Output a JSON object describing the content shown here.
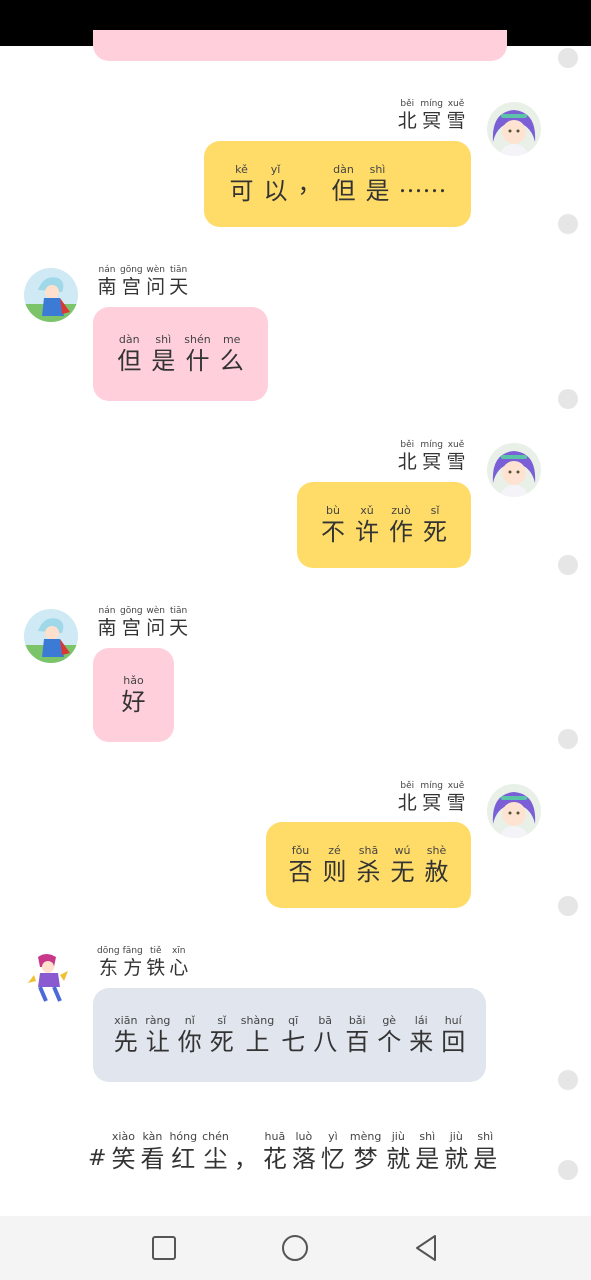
{
  "messages": [
    {
      "side": "right",
      "sender": "beiming",
      "name": [
        [
          "běi",
          "北"
        ],
        [
          "míng",
          "冥"
        ],
        [
          "xuě",
          "雪"
        ]
      ],
      "text": [
        [
          "kě",
          "可"
        ],
        [
          "yǐ",
          "以"
        ],
        [
          "",
          "，"
        ],
        [
          "dàn",
          "但"
        ],
        [
          "shì",
          "是"
        ],
        [
          "",
          "……"
        ]
      ]
    },
    {
      "side": "left",
      "sender": "nangong",
      "name": [
        [
          "nán",
          "南"
        ],
        [
          "gōng",
          "宫"
        ],
        [
          "wèn",
          "问"
        ],
        [
          "tiān",
          "天"
        ]
      ],
      "text": [
        [
          "dàn",
          "但"
        ],
        [
          "shì",
          "是"
        ],
        [
          "shén",
          "什"
        ],
        [
          "me",
          "么"
        ]
      ]
    },
    {
      "side": "right",
      "sender": "beiming",
      "name": [
        [
          "běi",
          "北"
        ],
        [
          "míng",
          "冥"
        ],
        [
          "xuě",
          "雪"
        ]
      ],
      "text": [
        [
          "bù",
          "不"
        ],
        [
          "xǔ",
          "许"
        ],
        [
          "zuò",
          "作"
        ],
        [
          "sǐ",
          "死"
        ]
      ]
    },
    {
      "side": "left",
      "sender": "nangong",
      "name": [
        [
          "nán",
          "南"
        ],
        [
          "gōng",
          "宫"
        ],
        [
          "wèn",
          "问"
        ],
        [
          "tiān",
          "天"
        ]
      ],
      "text": [
        [
          "hǎo",
          "好"
        ]
      ]
    },
    {
      "side": "right",
      "sender": "beiming",
      "name": [
        [
          "běi",
          "北"
        ],
        [
          "míng",
          "冥"
        ],
        [
          "xuě",
          "雪"
        ]
      ],
      "text": [
        [
          "fǒu",
          "否"
        ],
        [
          "zé",
          "则"
        ],
        [
          "shā",
          "杀"
        ],
        [
          "wú",
          "无"
        ],
        [
          "shè",
          "赦"
        ]
      ]
    },
    {
      "side": "left",
      "sender": "dongfang",
      "name": [
        [
          "dōng",
          "东"
        ],
        [
          "fāng",
          "方"
        ],
        [
          "tiě",
          "铁"
        ],
        [
          "xīn",
          "心"
        ]
      ],
      "text": [
        [
          "xiān",
          "先"
        ],
        [
          "ràng",
          "让"
        ],
        [
          "nǐ",
          "你"
        ],
        [
          "sǐ",
          "死"
        ],
        [
          "shàng",
          "上"
        ],
        [
          "qī",
          "七"
        ],
        [
          "bā",
          "八"
        ],
        [
          "bǎi",
          "百"
        ],
        [
          "gè",
          "个"
        ],
        [
          "lái",
          "来"
        ],
        [
          "huí",
          "回"
        ]
      ]
    }
  ],
  "caption": {
    "prefix": "#",
    "text": [
      [
        "xiào",
        "笑"
      ],
      [
        "kàn",
        "看"
      ],
      [
        "hóng",
        "红"
      ],
      [
        "chén",
        "尘"
      ],
      [
        "",
        "，"
      ],
      [
        "huā",
        "花"
      ],
      [
        "luò",
        "落"
      ],
      [
        "yì",
        "忆"
      ],
      [
        "mèng",
        "梦"
      ],
      [
        "jiù",
        "就"
      ],
      [
        "shì",
        "是"
      ],
      [
        "jiù",
        "就"
      ],
      [
        "shì",
        "是"
      ]
    ]
  },
  "colors": {
    "pink_bubble": "#ffd0dc",
    "yellow_bubble": "#ffdc68",
    "gray_bubble": "#e0e5ee"
  },
  "nav": {
    "recent_icon": "square-icon",
    "home_icon": "circle-icon",
    "back_icon": "triangle-back-icon"
  }
}
